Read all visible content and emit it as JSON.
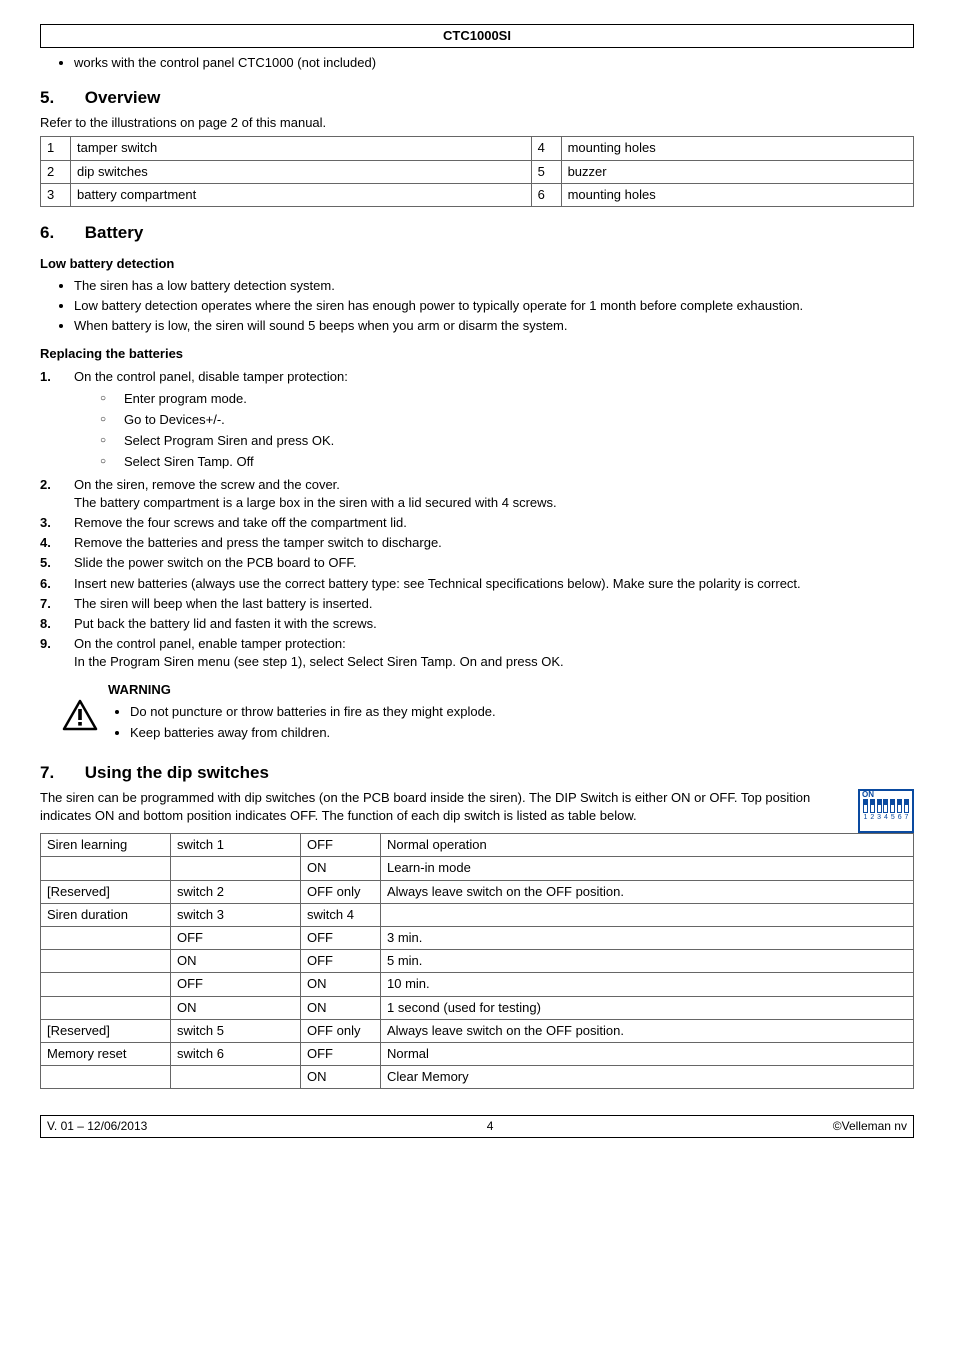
{
  "header": {
    "title": "CTC1000SI"
  },
  "top_bullet": "works with the control panel CTC1000 (not included)",
  "section5": {
    "num": "5.",
    "title": "Overview",
    "intro": "Refer to the illustrations on page 2 of this manual.",
    "parts": [
      {
        "n1": "1",
        "d1": "tamper switch",
        "n2": "4",
        "d2": "mounting holes"
      },
      {
        "n1": "2",
        "d1": "dip switches",
        "n2": "5",
        "d2": "buzzer"
      },
      {
        "n1": "3",
        "d1": "battery compartment",
        "n2": "6",
        "d2": "mounting holes"
      }
    ]
  },
  "section6": {
    "num": "6.",
    "title": "Battery",
    "low_heading": "Low battery detection",
    "low_bullets": [
      "The siren has a low battery detection system.",
      "Low battery detection operates where the siren has enough power to typically operate for 1 month before complete exhaustion.",
      "When battery is low, the siren will sound 5 beeps when you arm or disarm the system."
    ],
    "rep_heading": "Replacing the batteries",
    "step1": "On the control panel, disable tamper protection:",
    "step1_subs": [
      "Enter program mode.",
      "Go to Devices+/-.",
      "Select Program Siren and press OK.",
      "Select Siren Tamp. Off"
    ],
    "step2a": "On the siren, remove the screw and the cover.",
    "step2b": "The battery compartment is a large box in the siren with a lid secured with 4 screws.",
    "steps_rest": [
      "Remove the four screws and take off the compartment lid.",
      "Remove the batteries and press the tamper switch to discharge.",
      "Slide the power switch on the PCB board to OFF.",
      "Insert new batteries (always use the correct battery type: see Technical specifications below). Make sure the polarity is correct.",
      "The siren will beep when the last battery is inserted.",
      "Put back the battery lid and fasten it with the screws."
    ],
    "step9a": "On the control panel, enable tamper protection:",
    "step9b": "In the Program Siren menu (see step 1), select Select Siren Tamp. On and press OK.",
    "warning_heading": "WARNING",
    "warning_bullets": [
      "Do not puncture or throw batteries in fire as they might explode.",
      "Keep batteries away from children."
    ]
  },
  "section7": {
    "num": "7.",
    "title": "Using the dip switches",
    "intro": "The siren can be programmed with dip switches (on the PCB board inside the siren). The DIP Switch is either ON or OFF. Top position indicates ON and bottom position indicates OFF. The function of each dip switch is listed as table below.",
    "dip_icon": {
      "on_label": "ON",
      "nums": [
        "1",
        "2",
        "3",
        "4",
        "5",
        "6",
        "7"
      ]
    },
    "rows": [
      {
        "c1": "Siren learning",
        "c2": "switch 1",
        "c3": "OFF",
        "c4": "Normal operation"
      },
      {
        "c1": "",
        "c2": "",
        "c3": "ON",
        "c4": "Learn-in mode"
      },
      {
        "c1": "[Reserved]",
        "c2": "switch 2",
        "c3": "OFF only",
        "c4": "Always leave switch on the OFF position."
      },
      {
        "c1": "Siren duration",
        "c2": "switch 3",
        "c3": "switch 4",
        "c4": ""
      },
      {
        "c1": "",
        "c2": "OFF",
        "c3": "OFF",
        "c4": "3 min."
      },
      {
        "c1": "",
        "c2": "ON",
        "c3": "OFF",
        "c4": "5 min."
      },
      {
        "c1": "",
        "c2": "OFF",
        "c3": "ON",
        "c4": "10 min."
      },
      {
        "c1": "",
        "c2": "ON",
        "c3": "ON",
        "c4": "1 second (used for testing)"
      },
      {
        "c1": "[Reserved]",
        "c2": "switch 5",
        "c3": "OFF only",
        "c4": "Always leave switch on the OFF position."
      },
      {
        "c1": "Memory reset",
        "c2": "switch 6",
        "c3": "OFF",
        "c4": "Normal"
      },
      {
        "c1": "",
        "c2": "",
        "c3": "ON",
        "c4": "Clear Memory"
      }
    ]
  },
  "footer": {
    "left": "V. 01 – 12/06/2013",
    "center": "4",
    "right": "©Velleman nv"
  }
}
